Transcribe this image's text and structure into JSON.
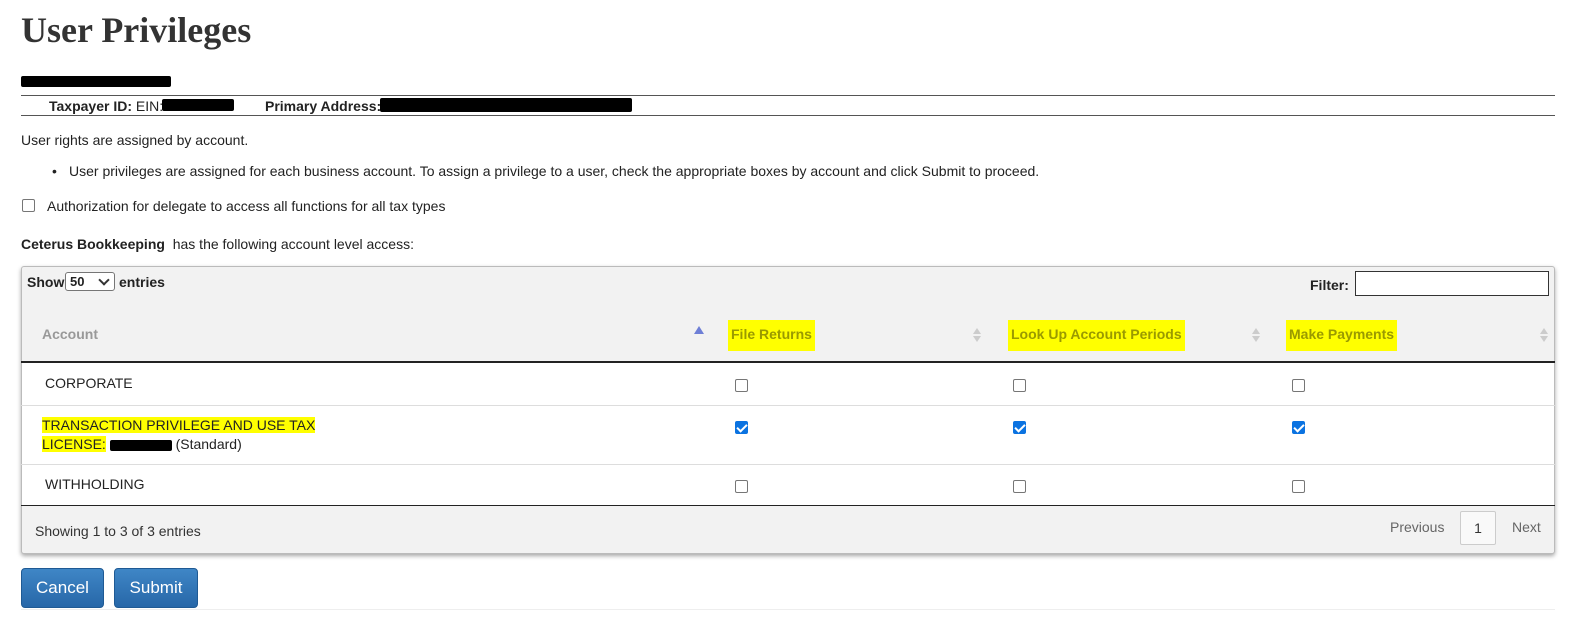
{
  "page": {
    "title": "User Privileges",
    "taxpayer_label": "Taxpayer ID:",
    "ein_label": "EIN:",
    "address_label": "Primary Address:",
    "rights_text": "User rights are assigned by account.",
    "bullet_text": "User privileges are assigned for each business account. To assign a privilege to a user, check the appropriate boxes by account and click Submit to proceed.",
    "authorization_label": "Authorization for delegate to access all functions for all tax types",
    "delegate_name": "Ceterus Bookkeeping",
    "delegate_suffix": "has the following account level access:"
  },
  "table": {
    "show_label": "Show",
    "entries_label": "entries",
    "page_length": "50",
    "filter_label": "Filter:",
    "columns": [
      "Account",
      "File Returns",
      "Look Up Account Periods",
      "Make Payments"
    ],
    "rows": [
      {
        "account": "CORPORATE",
        "file_returns": false,
        "look_up": false,
        "make_payments": false
      },
      {
        "account_line1": "TRANSACTION PRIVILEGE AND USE TAX",
        "account_line2_prefix": "LICENSE:",
        "account_line2_suffix": "(Standard)",
        "file_returns": true,
        "look_up": true,
        "make_payments": true
      },
      {
        "account": "WITHHOLDING",
        "file_returns": false,
        "look_up": false,
        "make_payments": false
      }
    ],
    "info": "Showing 1 to 3 of 3 entries",
    "pagination": {
      "previous": "Previous",
      "current": "1",
      "next": "Next"
    }
  },
  "actions": {
    "cancel": "Cancel",
    "submit": "Submit"
  },
  "colors": {
    "highlight": "#ffff00",
    "checkbox": "#0b73e1",
    "button": "#2f75b8"
  }
}
